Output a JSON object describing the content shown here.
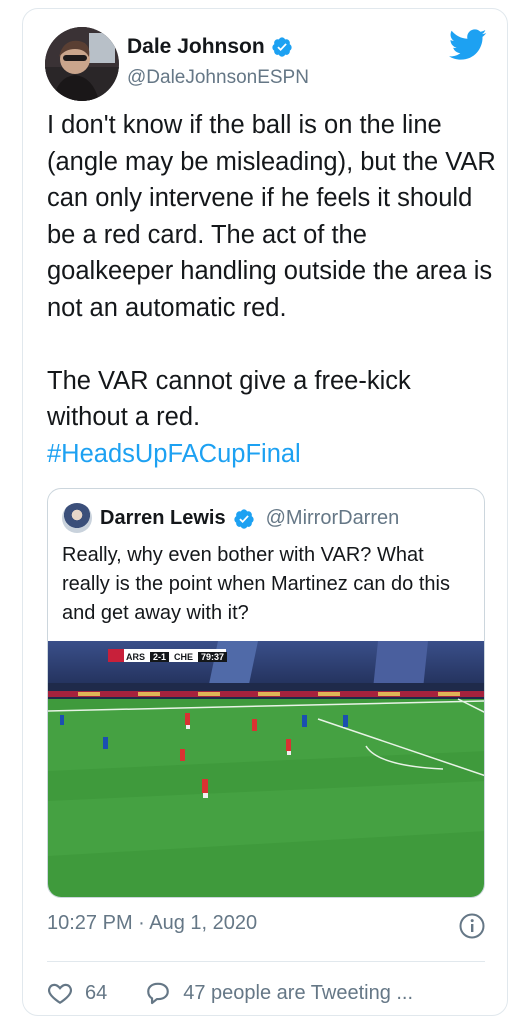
{
  "author": {
    "name": "Dale Johnson",
    "handle": "@DaleJohnsonESPN"
  },
  "tweet": {
    "text": "I don't know if the ball is on the line (angle may be misleading), but the VAR can only intervene if he feels it should be a red card. The act of the goalkeeper handling outside the area is not an automatic red.\n\nThe VAR cannot give a free-kick without a red.\n",
    "hashtag": "#HeadsUpFACupFinal"
  },
  "quoted": {
    "name": "Darren Lewis",
    "handle": "@MirrorDarren",
    "text": "Really, why even bother with VAR? What really is the point when Martinez can do this and get away with it?",
    "scoreboard": {
      "home": "ARS",
      "score": "2-1",
      "away": "CHE",
      "clock": "79:37"
    }
  },
  "meta": {
    "timestamp": "10:27 PM · Aug 1, 2020"
  },
  "actions": {
    "likes": "64",
    "tweeting": "47 people are Tweeting ..."
  },
  "colors": {
    "accent": "#1da1f2",
    "muted": "#657786",
    "text": "#14171a",
    "pitch": "#3f9a3c"
  }
}
